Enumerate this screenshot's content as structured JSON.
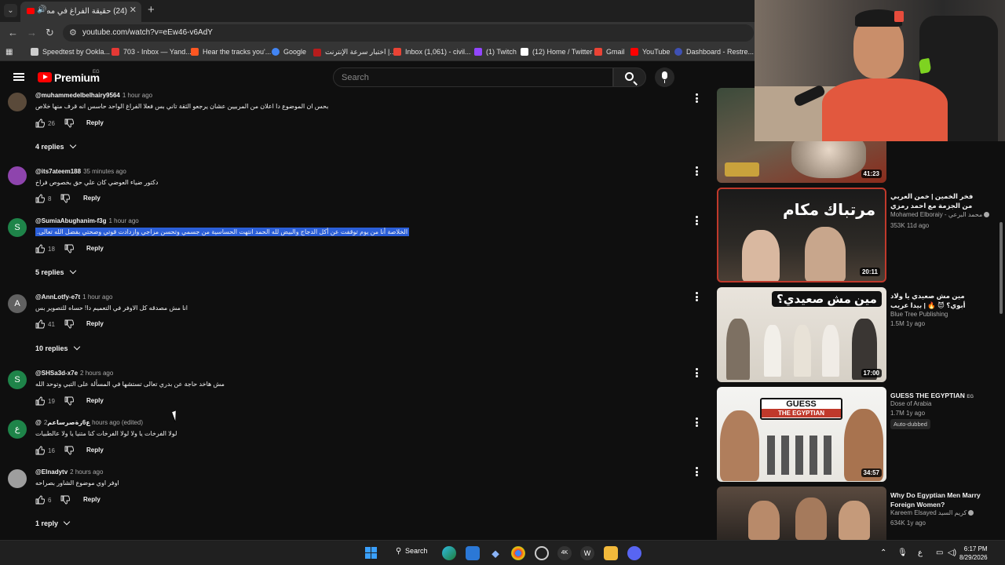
{
  "browser": {
    "tab_title": "(24) حقيقة الفراغ في مصر- قبل ...",
    "url": "youtube.com/watch?v=eEw46-v6AdY",
    "bookmarks": [
      {
        "label": "Speedtest by Ookla...",
        "color": "#cccccc"
      },
      {
        "label": "703 - Inbox — Yand...",
        "color": "#e53935"
      },
      {
        "label": "Hear the tracks you'...",
        "color": "#ff5722"
      },
      {
        "label": "Google",
        "color": "#4285f4"
      },
      {
        "label": "اختبار سرعة الإنترنت |...",
        "color": "#b71c1c"
      },
      {
        "label": "Inbox (1,061) - civil...",
        "color": "#ea4335"
      },
      {
        "label": "(1) Twitch",
        "color": "#9146ff"
      },
      {
        "label": "(12) Home / Twitter",
        "color": "#ffffff"
      },
      {
        "label": "Gmail",
        "color": "#ea4335"
      },
      {
        "label": "YouTube",
        "color": "#ff0000"
      },
      {
        "label": "Dashboard - Restre...",
        "color": "#3f51b5"
      }
    ]
  },
  "youtube": {
    "brand": "Premium",
    "region": "EG",
    "search_placeholder": "Search"
  },
  "comments": [
    {
      "author": "@muhammedelbelhairy9564",
      "time": "1 hour ago",
      "text": "بحس ان الموضوع دا اعلان من المربيين عشان يرجعو الثقة تاني بس فعلا الفراغ الواحد حاسس انه قرف منها خلاص",
      "likes": "26",
      "reply": "Reply",
      "avatar": "",
      "avatar_color": "#5a4a3a",
      "replies": "4 replies",
      "highlight": false
    },
    {
      "author": "@its7ateem188",
      "time": "35 minutes ago",
      "text": "دكتور ضياء العوضي كان علي حق بخصوص فراخ",
      "likes": "8",
      "reply": "Reply",
      "avatar": "",
      "avatar_color": "#8e44ad",
      "replies": "",
      "highlight": false
    },
    {
      "author": "@SumiaAbughanim-f3g",
      "time": "1 hour ago",
      "text": "الخلاصة أنا من يوم توقفت عن أكل الدجاج والبيض لله الحمد انتهت الحساسية من جسمي وتحسن مزاجي وازدادت قوتي وصحتي بفضل الله تعالى.",
      "likes": "18",
      "reply": "Reply",
      "avatar": "S",
      "avatar_color": "#1e8449",
      "replies": "5 replies",
      "highlight": true
    },
    {
      "author": "@AnnLotfy-e7t",
      "time": "1 hour ago",
      "text": "انا مش مصدقه كل الاوفر في التعميم دا! حساه للتصوير بس",
      "likes": "41",
      "reply": "Reply",
      "avatar": "A",
      "avatar_color": "#616161",
      "replies": "10 replies",
      "highlight": false
    },
    {
      "author": "@SHSa3d-x7e",
      "time": "2 hours ago",
      "text": "مش هاخد حاجة عن بدري تعالى تستشها في المسألة على التبي وتوحد الله",
      "likes": "19",
      "reply": "Reply",
      "avatar": "S",
      "avatar_color": "#1e8449",
      "replies": "",
      "highlight": false
    },
    {
      "author": "@ع6ﺯﺓصرﺳﺎﻋﻢ",
      "time": "2 hours ago (edited)",
      "text": "لولا الفرخات يا ولا لولا الفرخات كنا متنيا يا ولا عالطبيات",
      "likes": "16",
      "reply": "Reply",
      "avatar": "ع",
      "avatar_color": "#1e8449",
      "replies": "",
      "highlight": false
    },
    {
      "author": "@Elnadytv",
      "time": "2 hours ago",
      "text": "اوفر اوي موضوع الشاور بصراحه",
      "likes": "6",
      "reply": "Reply",
      "avatar": "",
      "avatar_color": "#9e9e9e",
      "replies": "1 reply",
      "highlight": false
    }
  ],
  "recommendations": [
    {
      "title": "",
      "channel": "",
      "meta": "",
      "duration": "41:23",
      "badge": ""
    },
    {
      "title": "فخر الخمين | خمن العربي من الجزمة مع احمد رمزي",
      "channel": "Mohamed Elboraiy - محمد البرعي",
      "meta": "353K  11d ago",
      "duration": "20:11",
      "badge": ""
    },
    {
      "title": "مين مش صعيدي يا ولاد أبوي؟ 😈 🔥 | بيدا عريب",
      "channel": "Blue Tree Publishing",
      "meta": "1.5M  1y ago",
      "duration": "17:00",
      "badge": ""
    },
    {
      "title": "GUESS THE EGYPTIAN",
      "region": "EG",
      "channel": "Dose of Arabia",
      "meta": "1.7M  1y ago",
      "duration": "34:57",
      "badge": "Auto-dubbed"
    },
    {
      "title": "Why Do Egyptian Men Marry Foreign Women?",
      "channel": "Kareem Elsayed كريم السيد",
      "meta": "634K  1y ago",
      "duration": "",
      "badge": ""
    }
  ],
  "thumbnail_text": {
    "t2": "مرتباك مكام",
    "t3": "مين مش صعيدي؟",
    "t4a": "GUESS",
    "t4b": "THE EGYPTIAN"
  },
  "taskbar": {
    "search_label": "Search",
    "time": "6:17 PM",
    "date": "8/29/2026",
    "lang": "ع"
  }
}
